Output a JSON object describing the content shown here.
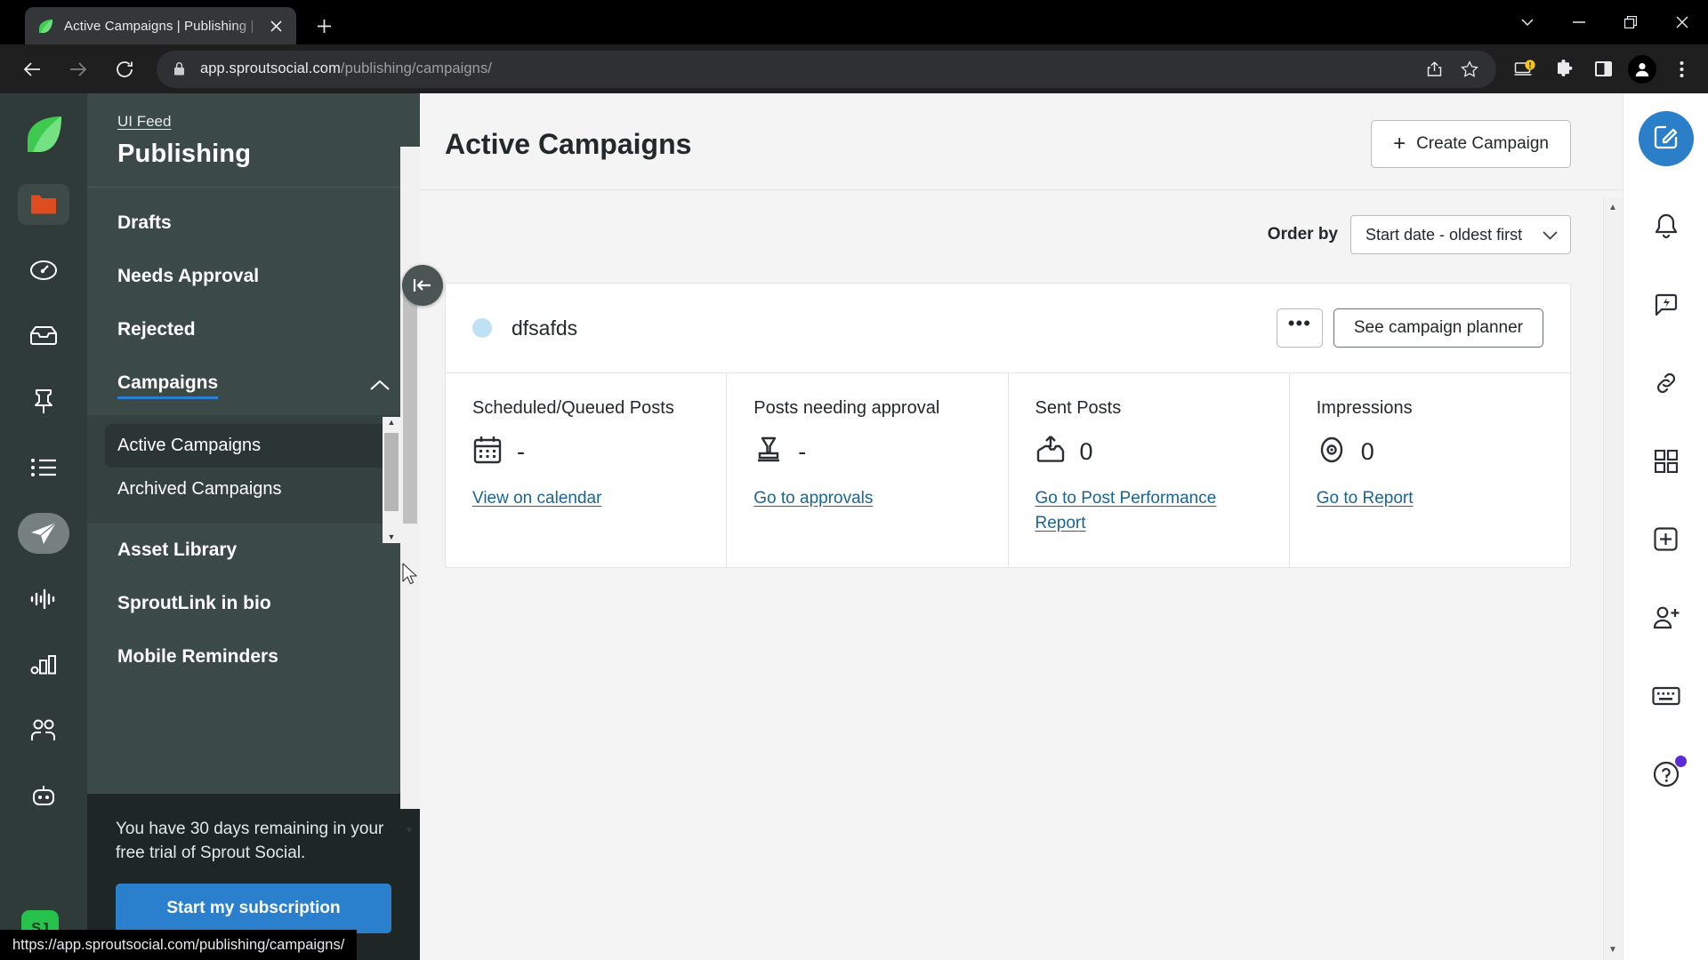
{
  "browser": {
    "tab": {
      "title": "Active Campaigns | Publishing |",
      "favicon": "sprout-leaf-icon",
      "close_icon": "close-icon"
    },
    "new_tab_icon": "plus-icon",
    "window_controls": [
      {
        "name": "tab-search-button",
        "icon": "chevron-down-icon"
      },
      {
        "name": "minimize-button",
        "icon": "minimize-icon"
      },
      {
        "name": "maximize-button",
        "icon": "maximize-icon"
      },
      {
        "name": "close-window-button",
        "icon": "close-icon"
      }
    ],
    "nav": {
      "back_icon": "back-arrow-icon",
      "forward_icon": "forward-arrow-icon",
      "reload_icon": "reload-icon"
    },
    "omnibox": {
      "lock_icon": "lock-icon",
      "url_host": "app.sproutsocial.com",
      "url_path": "/publishing/campaigns/",
      "share_icon": "share-icon",
      "bookmark_icon": "star-icon"
    },
    "toolbar_icons": [
      {
        "name": "device-notice-icon",
        "icon": "laptop-warning-icon"
      },
      {
        "name": "extensions-icon",
        "icon": "puzzle-icon"
      },
      {
        "name": "side-panel-icon",
        "icon": "panel-icon"
      },
      {
        "name": "profile-avatar",
        "icon": "person-icon"
      },
      {
        "name": "chrome-menu-icon",
        "icon": "three-dots-vertical-icon"
      }
    ],
    "status_bar_url": "https://app.sproutsocial.com/publishing/campaigns/"
  },
  "app_rail": {
    "logo": "sprout-leaf-logo",
    "items": [
      {
        "name": "rail-item-folder",
        "icon": "folder-icon",
        "state": "boxed"
      },
      {
        "name": "rail-item-dashboard",
        "icon": "speedometer-icon",
        "state": "normal"
      },
      {
        "name": "rail-item-inbox",
        "icon": "inbox-icon",
        "state": "normal"
      },
      {
        "name": "rail-item-pin",
        "icon": "pin-icon",
        "state": "normal"
      },
      {
        "name": "rail-item-listening",
        "icon": "list-icon",
        "state": "normal"
      },
      {
        "name": "rail-item-publishing",
        "icon": "paper-plane-icon",
        "state": "active"
      },
      {
        "name": "rail-item-analytics-wave",
        "icon": "waveform-icon",
        "state": "normal"
      },
      {
        "name": "rail-item-reports",
        "icon": "bar-chart-icon",
        "state": "normal"
      },
      {
        "name": "rail-item-audience",
        "icon": "people-icon",
        "state": "normal"
      },
      {
        "name": "rail-item-bot",
        "icon": "chat-bot-icon",
        "state": "normal"
      }
    ],
    "avatar_initials": "SJ"
  },
  "sidebar": {
    "breadcrumb": "UI Feed",
    "title": "Publishing",
    "collapse_icon": "collapse-sidebar-icon",
    "items": [
      {
        "label": "Drafts"
      },
      {
        "label": "Needs Approval"
      },
      {
        "label": "Rejected"
      },
      {
        "label": "Campaigns"
      }
    ],
    "campaigns_chevron": "chevron-up-icon",
    "subitems": [
      {
        "label": "Active Campaigns",
        "selected": true
      },
      {
        "label": "Archived Campaigns",
        "selected": false
      }
    ],
    "items_after": [
      {
        "label": "Asset Library"
      },
      {
        "label": "SproutLink in bio"
      },
      {
        "label": "Mobile Reminders"
      }
    ],
    "trial": {
      "message": "You have 30 days remaining in your free trial of Sprout Social.",
      "button_label": "Start my subscription"
    }
  },
  "main": {
    "page_title": "Active Campaigns",
    "create_button": {
      "label": "Create Campaign",
      "icon": "plus-icon"
    },
    "order_by": {
      "label": "Order by",
      "value": "Start date - oldest first",
      "chevron": "chevron-down-icon"
    },
    "campaign": {
      "status_dot_color": "#bfe0f5",
      "name": "dfsafds",
      "more_button_label": "•••",
      "planner_button_label": "See campaign planner",
      "stats": [
        {
          "label": "Scheduled/Queued Posts",
          "icon": "calendar-icon",
          "value": "-",
          "link": "View on calendar"
        },
        {
          "label": "Posts needing approval",
          "icon": "approval-stamp-icon",
          "value": "-",
          "link": "Go to approvals"
        },
        {
          "label": "Sent Posts",
          "icon": "outbox-upload-icon",
          "value": "0",
          "link": "Go to Post Performance Report"
        },
        {
          "label": "Impressions",
          "icon": "eye-icon",
          "value": "0",
          "link": "Go to Report"
        }
      ]
    }
  },
  "right_rail": {
    "compose": {
      "name": "compose-button",
      "icon": "compose-pencil-icon",
      "color": "#2b7fc9"
    },
    "items": [
      {
        "name": "notifications-button",
        "icon": "bell-icon"
      },
      {
        "name": "messages-button",
        "icon": "lightning-message-icon"
      },
      {
        "name": "links-button",
        "icon": "link-chain-icon"
      },
      {
        "name": "apps-button",
        "icon": "grid-apps-icon"
      },
      {
        "name": "add-button",
        "icon": "plus-square-icon"
      },
      {
        "name": "invite-user-button",
        "icon": "person-add-icon"
      },
      {
        "name": "keyboard-shortcuts-button",
        "icon": "keyboard-icon"
      },
      {
        "name": "help-button",
        "icon": "question-circle-icon",
        "badge": true
      }
    ]
  }
}
